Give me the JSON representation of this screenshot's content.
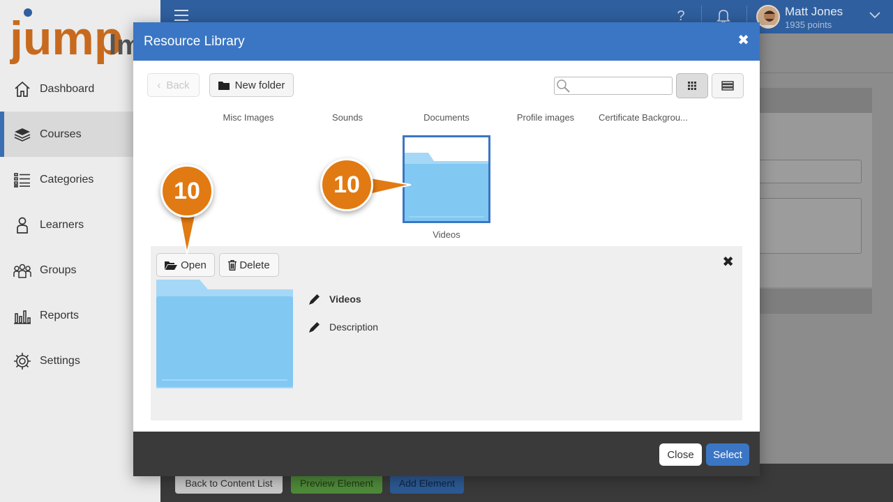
{
  "app": {
    "logo_text": "jump",
    "logo_text_cut": "lm",
    "sidebar": {
      "items": [
        {
          "label": "Dashboard",
          "icon": "home-icon"
        },
        {
          "label": "Courses",
          "icon": "books-icon",
          "active": true
        },
        {
          "label": "Categories",
          "icon": "list-icon"
        },
        {
          "label": "Learners",
          "icon": "person-icon"
        },
        {
          "label": "Groups",
          "icon": "group-icon"
        },
        {
          "label": "Reports",
          "icon": "bar-chart-icon"
        },
        {
          "label": "Settings",
          "icon": "gear-icon"
        }
      ]
    },
    "user": {
      "name": "Matt Jones",
      "points": "1935 points"
    },
    "bottom_bar": {
      "back_label": "Back to Content List",
      "preview_label": "Preview Element",
      "add_label": "Add Element"
    }
  },
  "modal": {
    "title": "Resource Library",
    "toolbar": {
      "back_label": "Back",
      "new_folder_label": "New folder",
      "search_value": "",
      "search_placeholder": ""
    },
    "folders": [
      {
        "name": "Misc Images"
      },
      {
        "name": "Sounds"
      },
      {
        "name": "Documents"
      },
      {
        "name": "Profile images"
      },
      {
        "name": "Certificate Backgrou..."
      }
    ],
    "selected_folder": {
      "name": "Videos"
    },
    "detail": {
      "open_label": "Open",
      "delete_label": "Delete",
      "name": "Videos",
      "description": "Description"
    },
    "footer": {
      "close_label": "Close",
      "select_label": "Select"
    }
  },
  "callouts": [
    {
      "number": "10"
    },
    {
      "number": "10"
    }
  ],
  "colors": {
    "modal_header": "#3b76c4",
    "folder_blue": "#81c8f2",
    "callout_orange": "#e17a12",
    "select_button": "#3b76c4"
  }
}
